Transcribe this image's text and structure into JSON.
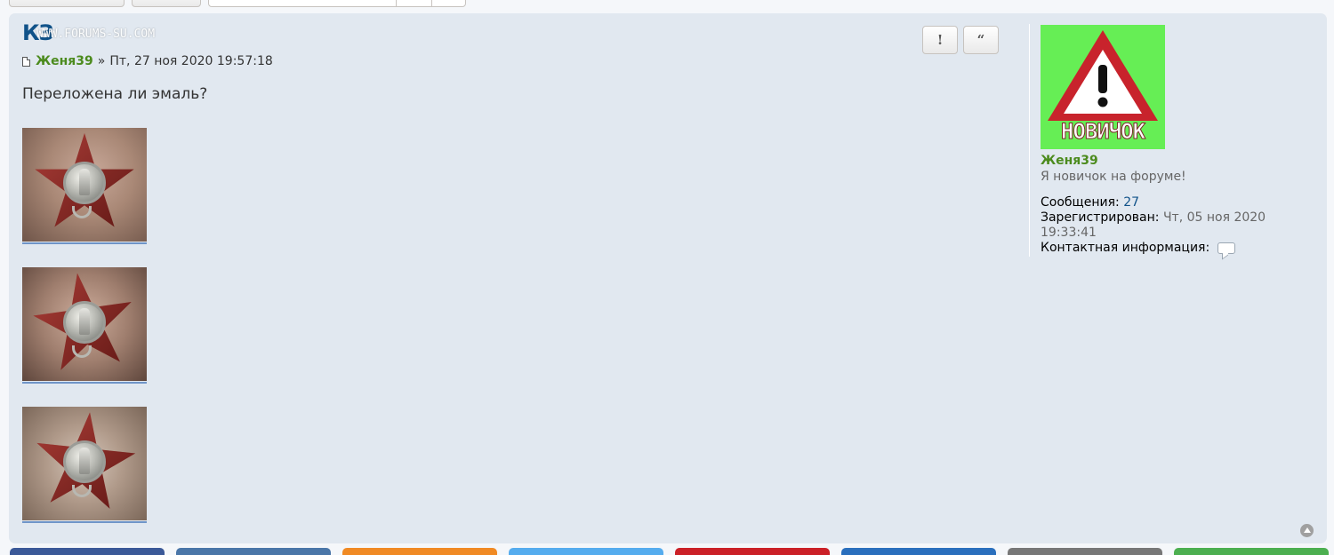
{
  "watermark": "WWW.FORUMS-SU.COM",
  "post": {
    "title": "КЗ",
    "author": "Женя39",
    "separator": "»",
    "date": "Пт, 27 ноя 2020 19:57:18",
    "content": "Переложена ли эмаль?",
    "buttons": {
      "report": "!",
      "quote": "“"
    },
    "attachments": 3
  },
  "profile": {
    "avatar_text": "НОВИЧОК",
    "name": "Женя39",
    "rank": "Я новичок на форуме!",
    "messages_label": "Сообщения:",
    "messages_value": "27",
    "registered_label": "Зарегистрирован:",
    "registered_value_1": "Чт, 05 ноя 2020",
    "registered_value_2": "19:33:41",
    "contact_label": "Контактная информация:"
  },
  "colors": {
    "panel": "#e1e8f0",
    "title": "#105289",
    "author": "#4c8b1e",
    "link": "#105289",
    "avatar_bg": "#66ee55",
    "sign_red": "#c8232c"
  },
  "share_colors": [
    "#3b5998",
    "#4a76a8",
    "#f08a24",
    "#55acee",
    "#cb2027",
    "#2a6fbd",
    "#777777",
    "#4caf50"
  ],
  "icons": [
    "post-icon",
    "report-icon",
    "quote-icon",
    "contact-icon",
    "back-to-top-icon",
    "warning-sign-icon"
  ]
}
